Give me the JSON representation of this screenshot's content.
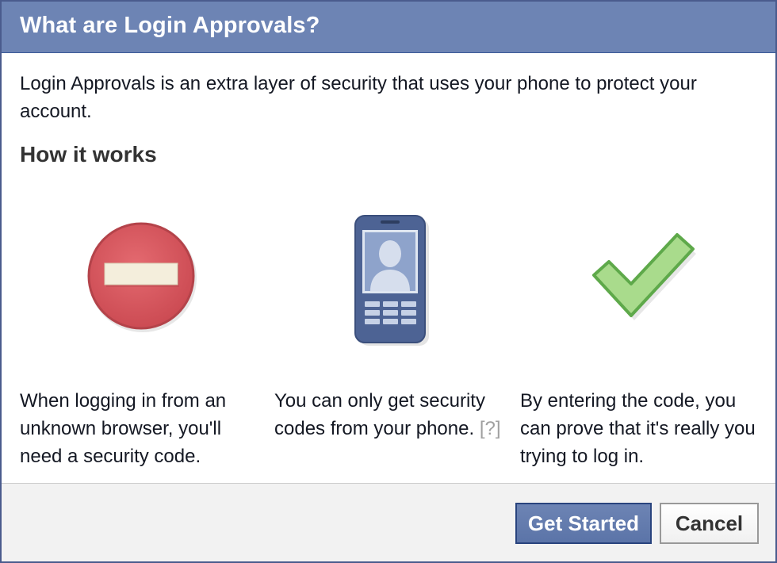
{
  "dialog": {
    "title": "What are Login Approvals?",
    "intro": "Login Approvals is an extra layer of security that uses your phone to protect your account.",
    "heading": "How it works"
  },
  "steps": [
    {
      "icon": "no-entry-icon",
      "text": "When logging in from an unknown browser, you'll need a security code."
    },
    {
      "icon": "phone-icon",
      "text": "You can only get security codes from your phone.",
      "help_link": "[?]"
    },
    {
      "icon": "checkmark-icon",
      "text": "By entering the code, you can prove that it's really you trying to log in."
    }
  ],
  "buttons": {
    "primary_label": "Get Started",
    "secondary_label": "Cancel"
  },
  "colors": {
    "titlebar": "#6d84b4",
    "primary_button": "#5b74a8",
    "stop_red": "#d9535b",
    "check_green": "#a6d98a"
  }
}
